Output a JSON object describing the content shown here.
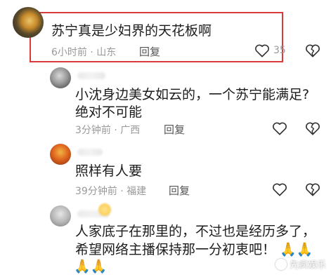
{
  "comments": [
    {
      "text": "苏宁真是少妇界的天花板啊",
      "time": "6小时前",
      "location": "山东",
      "reply_label": "回复",
      "likes": "35"
    },
    {
      "line1": "小沈身边美女如云的，一个苏宁能满足?",
      "line2": "绝对不可能",
      "time": "3分钟前",
      "location": "广西",
      "reply_label": "回复"
    },
    {
      "text": "照样有人要",
      "time": "39分钟前",
      "location": "福建",
      "reply_label": "回复"
    },
    {
      "line1": "人家底子在那里的，不过也是经历多了，",
      "line2": "希望网络主播保持那一分初衷吧！",
      "emoji_pray": "🙏🙏",
      "line3_emoji": "🙏🙏"
    }
  ],
  "separator": "·",
  "watermark": "先疯娱乐",
  "colors": {
    "highlight": "#d93a3a",
    "meta": "#9a9a9a"
  },
  "icons": [
    "heart-outline-icon",
    "broken-heart-icon"
  ]
}
